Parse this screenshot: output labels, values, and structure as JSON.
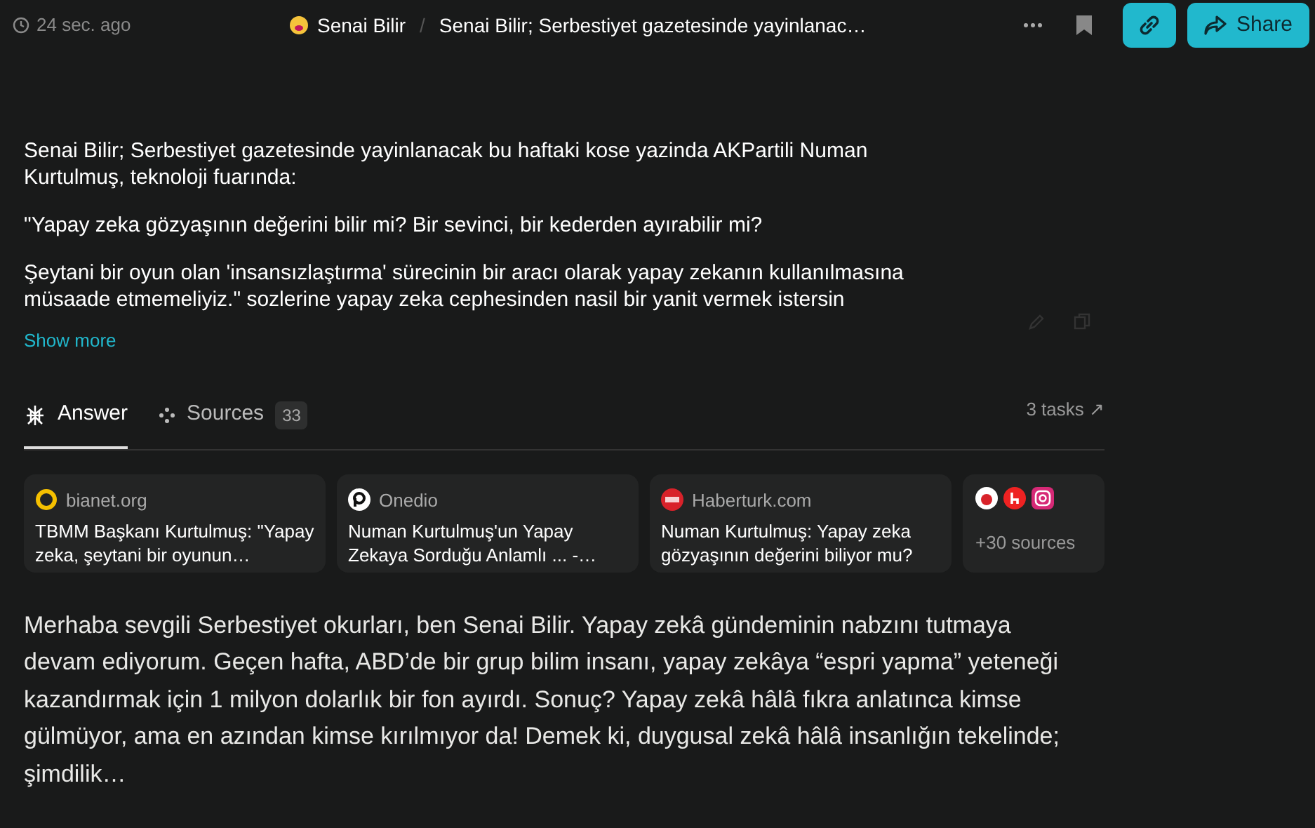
{
  "header": {
    "time": "24 sec. ago",
    "author": "Senai Bilir",
    "separator": "/",
    "title": "Senai Bilir; Serbestiyet gazetesinde yayinlanac…",
    "share": "Share"
  },
  "query": {
    "paragraphs": [
      "Senai Bilir; Serbestiyet gazetesinde yayinlanacak bu haftaki kose yazinda AKPartili Numan Kurtulmuş, teknoloji fuarında:",
      "\"Yapay zeka gözyaşının değerini bilir mi? Bir sevinci, bir kederden ayırabilir mi?",
      "Şeytani bir oyun olan 'insansızlaştırma' sürecinin bir aracı olarak yapay zekanın kullanılmasına müsaade etmemeliyiz.\" sozlerine yapay zeka cephesinden nasil bir yanit vermek istersin"
    ],
    "show_more": "Show more"
  },
  "tabs": [
    {
      "kind": "answer",
      "label": "Answer",
      "selected": true
    },
    {
      "kind": "sources",
      "label": "Sources",
      "count": "33",
      "selected": false
    }
  ],
  "tasks": "3 tasks ↗",
  "sources": [
    {
      "kind": "ring",
      "site": "bianet.org",
      "title": "TBMM Başkanı Kurtulmuş: \"Yapay zeka, şeytani bir oyunun…"
    },
    {
      "kind": "p",
      "site": "Onedio",
      "title": "Numan Kurtulmuş'un Yapay Zekaya Sorduğu Anlamlı ... -…"
    },
    {
      "kind": "square",
      "site": "Haberturk.com",
      "title": "Numan Kurtulmuş: Yapay zeka gözyaşının değerini biliyor mu?"
    }
  ],
  "more_sources": "+30 sources",
  "answer": "Merhaba sevgili Serbestiyet okurları, ben Senai Bilir. Yapay zekâ gündeminin nabzını tutmaya devam ediyorum. Geçen hafta, ABD’de bir grup bilim insanı, yapay zekâya “espri yapma” yeteneği kazandırmak için 1 milyon dolarlık bir fon ayırdı. Sonuç? Yapay zekâ hâlâ fıkra anlatınca kimse gülmüyor, ama en azından kimse kırılmıyor da! Demek ki, duygusal zekâ hâlâ insanlığın tekelinde; şimdilik…"
}
